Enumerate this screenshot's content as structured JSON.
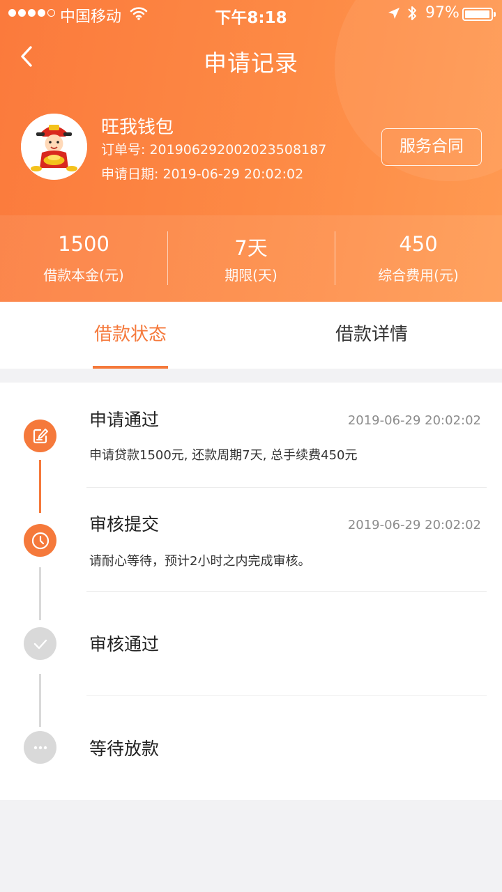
{
  "status_bar": {
    "carrier": "中国移动",
    "time": "下午8:18",
    "battery": "97%",
    "battery_level": 0.97
  },
  "nav": {
    "title": "申请记录"
  },
  "profile": {
    "app_name": "旺我钱包",
    "order_label": "订单号: 2019062920020235081​87",
    "date_label": "申请日期: 2019-06-29 20:02:02",
    "contract_button": "服务合同"
  },
  "stats": [
    {
      "value": "1500",
      "label": "借款本金(元)"
    },
    {
      "value": "7天",
      "label": "期限(天)"
    },
    {
      "value": "450",
      "label": "综合费用(元)"
    }
  ],
  "tabs": {
    "active": "借款状态",
    "other": "借款详情"
  },
  "steps": [
    {
      "title": "申请通过",
      "time": "2019-06-29 20:02:02",
      "desc": "申请贷款1500元, 还款周期7天, 总手续费450元"
    },
    {
      "title": "审核提交",
      "time": "2019-06-29 20:02:02",
      "desc": "请耐心等待，预计2小时之内完成审核。"
    },
    {
      "title": "审核通过"
    },
    {
      "title": "等待放款"
    }
  ],
  "colors": {
    "accent": "#f5793b",
    "inactive": "#d9d9d9",
    "header_start": "#fb7a3c",
    "header_end": "#ff9a52"
  }
}
